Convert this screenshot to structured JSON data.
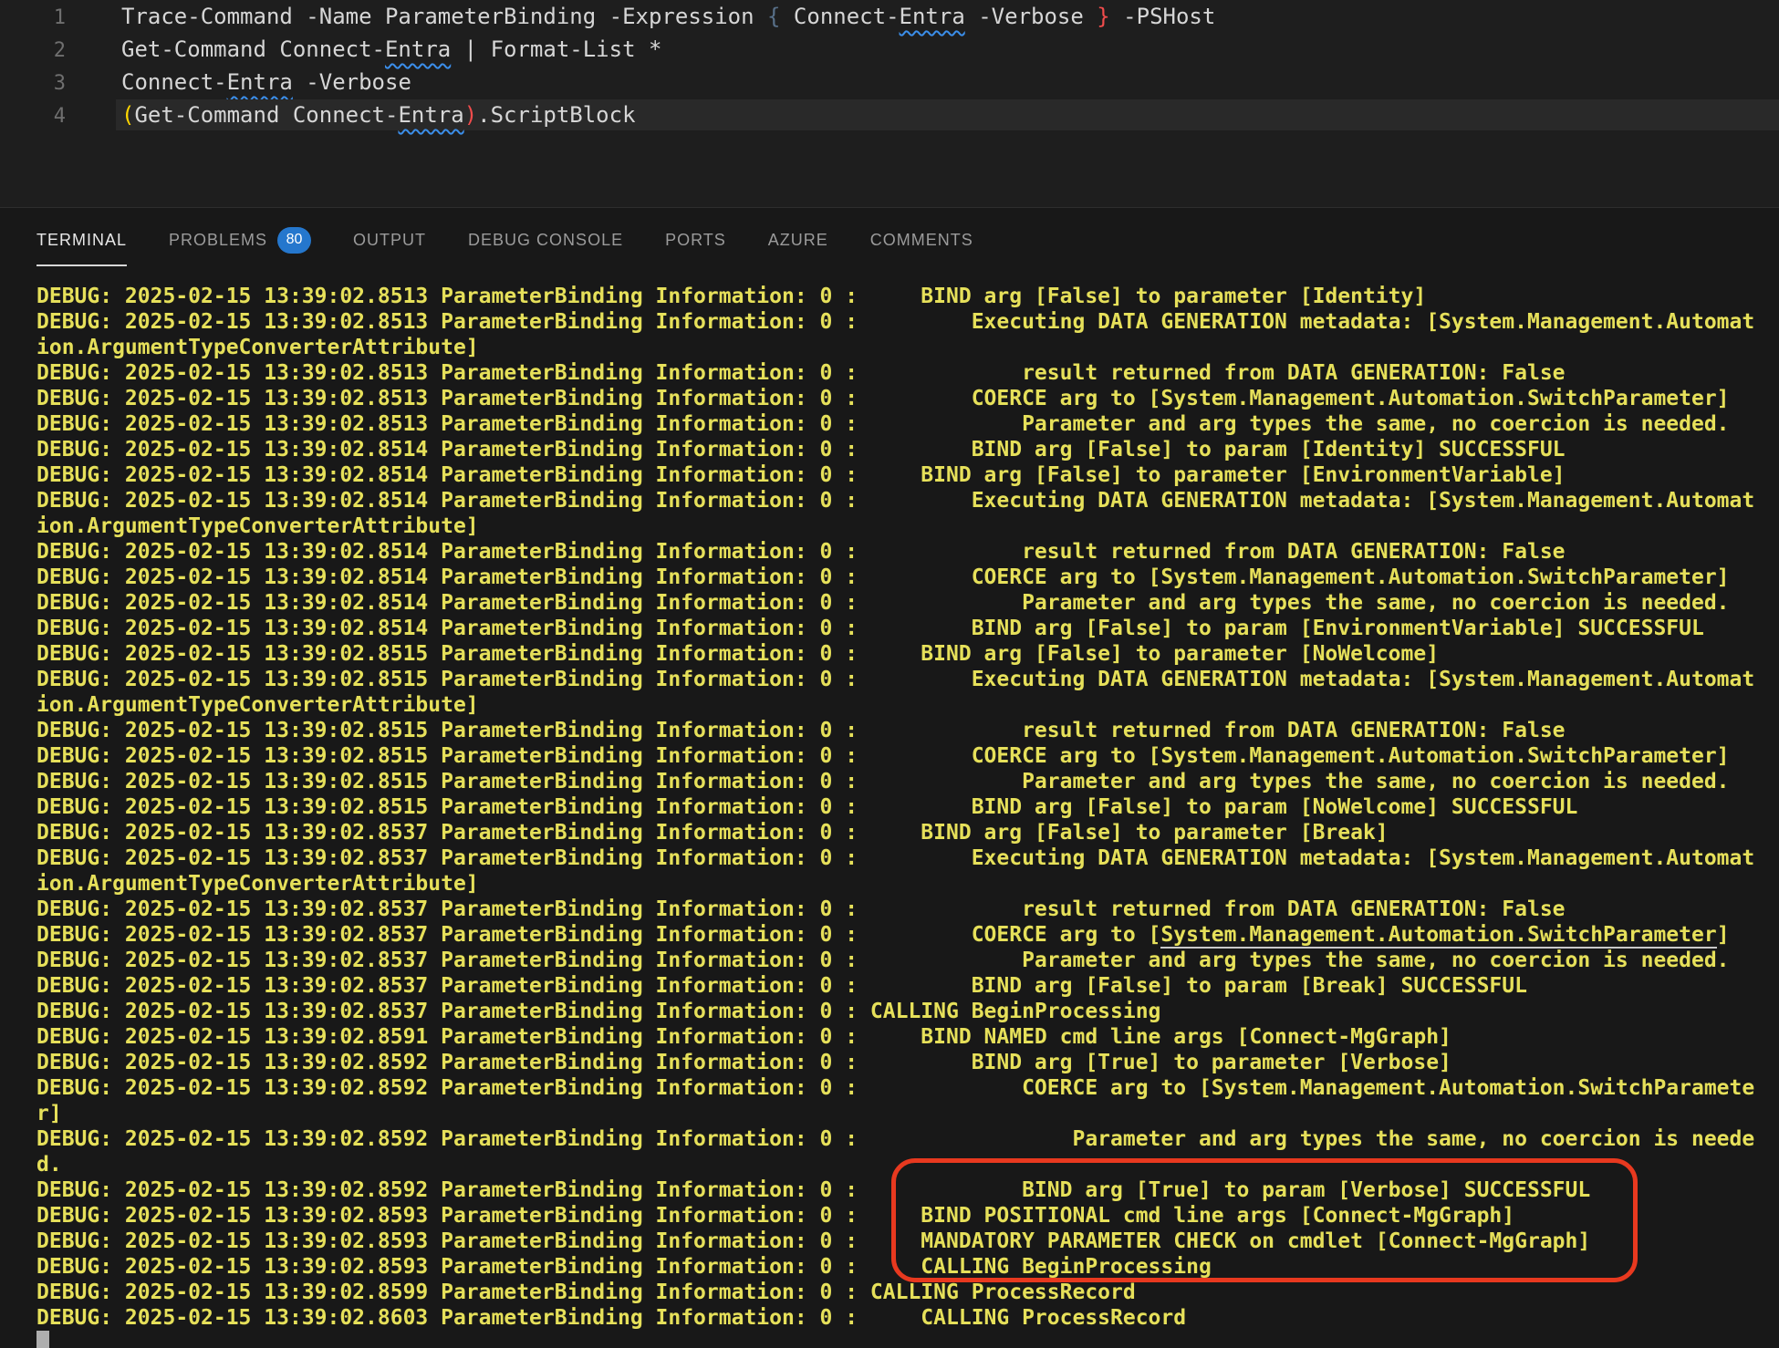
{
  "editor": {
    "lines": [
      {
        "num": "1",
        "current": false,
        "segments": [
          {
            "t": "Trace-Command -Name ParameterBinding -Expression "
          },
          {
            "t": "{",
            "c": "bo"
          },
          {
            "t": " Connect-"
          },
          {
            "t": "Entra",
            "c": "sq"
          },
          {
            "t": " -Verbose "
          },
          {
            "t": "}",
            "c": "br"
          },
          {
            "t": " -PSHost"
          }
        ]
      },
      {
        "num": "2",
        "current": false,
        "segments": [
          {
            "t": "Get-Command Connect-"
          },
          {
            "t": "Entra",
            "c": "sq"
          },
          {
            "t": " | Format-List *"
          }
        ]
      },
      {
        "num": "3",
        "current": false,
        "segments": [
          {
            "t": "Connect-"
          },
          {
            "t": "Entra",
            "c": "sq"
          },
          {
            "t": " -Verbose"
          }
        ]
      },
      {
        "num": "4",
        "current": true,
        "segments": [
          {
            "t": "(",
            "c": "pg"
          },
          {
            "t": "Get-Command Connect-"
          },
          {
            "t": "Entra",
            "c": "sq"
          },
          {
            "t": ")",
            "c": "pr"
          },
          {
            "t": ".ScriptBlock"
          }
        ]
      }
    ]
  },
  "panel": {
    "tabs": [
      {
        "label": "TERMINAL",
        "active": true
      },
      {
        "label": "PROBLEMS",
        "active": false,
        "badge": "80"
      },
      {
        "label": "OUTPUT",
        "active": false
      },
      {
        "label": "DEBUG CONSOLE",
        "active": false
      },
      {
        "label": "PORTS",
        "active": false
      },
      {
        "label": "AZURE",
        "active": false
      },
      {
        "label": "COMMENTS",
        "active": false
      }
    ]
  },
  "terminal": {
    "prefix": {
      "label": "DEBUG:",
      "date": "2025-02-15",
      "source": "ParameterBinding",
      "level": "Information:",
      "id": "0",
      "sep": ":"
    },
    "cursor_visible": true,
    "rows": [
      {
        "time": "13:39:02.8513",
        "indent": 4,
        "text": "BIND arg [False] to parameter [Identity]"
      },
      {
        "time": "13:39:02.8513",
        "indent": 8,
        "text": "Executing DATA GENERATION metadata: [System.Management.Automat"
      },
      {
        "wrap": true,
        "text": "ion.ArgumentTypeConverterAttribute]"
      },
      {
        "time": "13:39:02.8513",
        "indent": 12,
        "text": "result returned from DATA GENERATION: False"
      },
      {
        "time": "13:39:02.8513",
        "indent": 8,
        "text": "COERCE arg to [System.Management.Automation.SwitchParameter]"
      },
      {
        "time": "13:39:02.8513",
        "indent": 12,
        "text": "Parameter and arg types the same, no coercion is needed."
      },
      {
        "time": "13:39:02.8514",
        "indent": 8,
        "text": "BIND arg [False] to param [Identity] SUCCESSFUL"
      },
      {
        "time": "13:39:02.8514",
        "indent": 4,
        "text": "BIND arg [False] to parameter [EnvironmentVariable]"
      },
      {
        "time": "13:39:02.8514",
        "indent": 8,
        "text": "Executing DATA GENERATION metadata: [System.Management.Automat"
      },
      {
        "wrap": true,
        "text": "ion.ArgumentTypeConverterAttribute]"
      },
      {
        "time": "13:39:02.8514",
        "indent": 12,
        "text": "result returned from DATA GENERATION: False"
      },
      {
        "time": "13:39:02.8514",
        "indent": 8,
        "text": "COERCE arg to [System.Management.Automation.SwitchParameter]"
      },
      {
        "time": "13:39:02.8514",
        "indent": 12,
        "text": "Parameter and arg types the same, no coercion is needed."
      },
      {
        "time": "13:39:02.8514",
        "indent": 8,
        "text": "BIND arg [False] to param [EnvironmentVariable] SUCCESSFUL"
      },
      {
        "time": "13:39:02.8515",
        "indent": 4,
        "text": "BIND arg [False] to parameter [NoWelcome]"
      },
      {
        "time": "13:39:02.8515",
        "indent": 8,
        "text": "Executing DATA GENERATION metadata: [System.Management.Automat"
      },
      {
        "wrap": true,
        "text": "ion.ArgumentTypeConverterAttribute]"
      },
      {
        "time": "13:39:02.8515",
        "indent": 12,
        "text": "result returned from DATA GENERATION: False"
      },
      {
        "time": "13:39:02.8515",
        "indent": 8,
        "text": "COERCE arg to [System.Management.Automation.SwitchParameter]"
      },
      {
        "time": "13:39:02.8515",
        "indent": 12,
        "text": "Parameter and arg types the same, no coercion is needed."
      },
      {
        "time": "13:39:02.8515",
        "indent": 8,
        "text": "BIND arg [False] to param [NoWelcome] SUCCESSFUL"
      },
      {
        "time": "13:39:02.8537",
        "indent": 4,
        "text": "BIND arg [False] to parameter [Break]"
      },
      {
        "time": "13:39:02.8537",
        "indent": 8,
        "text": "Executing DATA GENERATION metadata: [System.Management.Automat"
      },
      {
        "wrap": true,
        "text": "ion.ArgumentTypeConverterAttribute]"
      },
      {
        "time": "13:39:02.8537",
        "indent": 12,
        "text": "result returned from DATA GENERATION: False"
      },
      {
        "time": "13:39:02.8537",
        "indent": 8,
        "pre": "COERCE arg to [",
        "link": "System.Management.Automation.SwitchParameter",
        "post": "]"
      },
      {
        "time": "13:39:02.8537",
        "indent": 12,
        "text": "Parameter and arg types the same, no coercion is needed."
      },
      {
        "time": "13:39:02.8537",
        "indent": 8,
        "text": "BIND arg [False] to param [Break] SUCCESSFUL"
      },
      {
        "time": "13:39:02.8537",
        "indent": 0,
        "text": "CALLING BeginProcessing"
      },
      {
        "time": "13:39:02.8591",
        "indent": 4,
        "text": "BIND NAMED cmd line args [Connect-MgGraph]"
      },
      {
        "time": "13:39:02.8592",
        "indent": 8,
        "text": "BIND arg [True] to parameter [Verbose]"
      },
      {
        "time": "13:39:02.8592",
        "indent": 12,
        "text": "COERCE arg to [System.Management.Automation.SwitchParamete"
      },
      {
        "wrap": true,
        "text": "r]"
      },
      {
        "time": "13:39:02.8592",
        "indent": 16,
        "text": "Parameter and arg types the same, no coercion is neede"
      },
      {
        "wrap": true,
        "text": "d."
      },
      {
        "time": "13:39:02.8592",
        "indent": 12,
        "text": "BIND arg [True] to param [Verbose] SUCCESSFUL"
      },
      {
        "time": "13:39:02.8593",
        "indent": 4,
        "text": "BIND POSITIONAL cmd line args [Connect-MgGraph]"
      },
      {
        "time": "13:39:02.8593",
        "indent": 4,
        "text": "MANDATORY PARAMETER CHECK on cmdlet [Connect-MgGraph]"
      },
      {
        "time": "13:39:02.8593",
        "indent": 4,
        "text": "CALLING BeginProcessing"
      },
      {
        "time": "13:39:02.8599",
        "indent": 0,
        "text": "CALLING ProcessRecord"
      },
      {
        "time": "13:39:02.8603",
        "indent": 4,
        "text": "CALLING ProcessRecord"
      }
    ]
  },
  "annotation": {
    "shape": "rounded-rect",
    "purpose": "highlights successful Verbose binding and Connect-MgGraph processing lines"
  },
  "colors": {
    "editor_bg": "#1e1e1e",
    "panel_bg": "#181818",
    "terminal_text": "#e6e05a",
    "annotation_red": "#e8391f",
    "badge_blue": "#2577cd",
    "squiggle_blue": "#3b8eea",
    "bracket_gold": "#ffd700",
    "bracket_red": "#f14c4c",
    "brace_slate": "#587089"
  }
}
